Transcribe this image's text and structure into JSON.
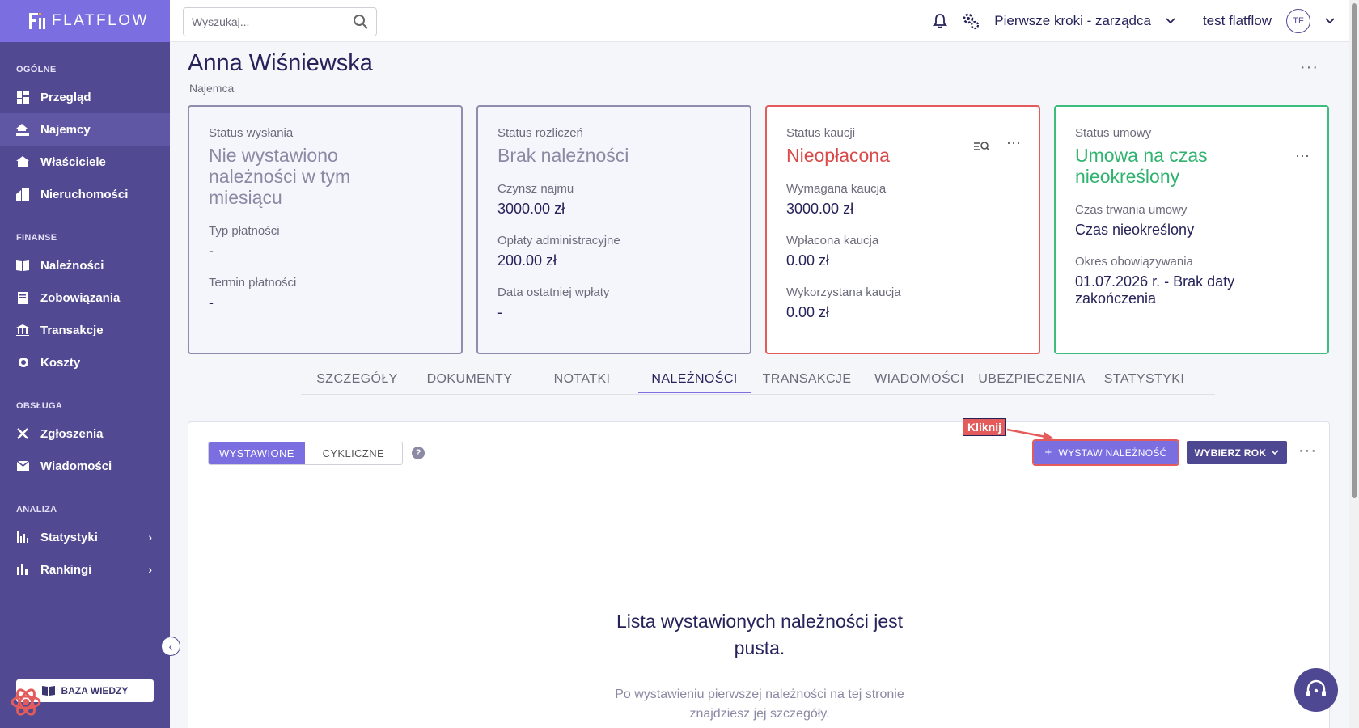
{
  "app": {
    "name": "FLATFLOW"
  },
  "search": {
    "placeholder": "Wyszukaj..."
  },
  "topbar": {
    "company": "Pierwsze kroki - zarządca",
    "user": "test flatflow",
    "avatar_initials": "TF"
  },
  "sidebar": {
    "sections": [
      {
        "title": "OGÓLNE",
        "items": [
          {
            "label": "Przegląd"
          },
          {
            "label": "Najemcy"
          },
          {
            "label": "Właściciele"
          },
          {
            "label": "Nieruchomości"
          }
        ]
      },
      {
        "title": "FINANSE",
        "items": [
          {
            "label": "Należności"
          },
          {
            "label": "Zobowiązania"
          },
          {
            "label": "Transakcje"
          },
          {
            "label": "Koszty"
          }
        ]
      },
      {
        "title": "OBSŁUGA",
        "items": [
          {
            "label": "Zgłoszenia"
          },
          {
            "label": "Wiadomości"
          }
        ]
      },
      {
        "title": "ANALIZA",
        "items": [
          {
            "label": "Statystyki"
          },
          {
            "label": "Rankingi"
          }
        ]
      }
    ],
    "knowledge_base": "BAZA WIEDZY"
  },
  "page": {
    "title": "Anna Wiśniewska",
    "subtitle": "Najemca"
  },
  "cards": {
    "sending": {
      "label": "Status wysłania",
      "status": "Nie wystawiono należności w tym miesiącu",
      "payment_type_label": "Typ płatności",
      "payment_type": "-",
      "deadline_label": "Termin płatności",
      "deadline": "-"
    },
    "settlements": {
      "label": "Status rozliczeń",
      "status": "Brak należności",
      "rent_label": "Czynsz najmu",
      "rent": "3000.00 zł",
      "fees_label": "Opłaty administracyjne",
      "fees": "200.00 zł",
      "last_payment_label": "Data ostatniej wpłaty",
      "last_payment": "-"
    },
    "deposit": {
      "label": "Status kaucji",
      "status": "Nieopłacona",
      "required_label": "Wymagana kaucja",
      "required": "3000.00 zł",
      "paid_label": "Wpłacona kaucja",
      "paid": "0.00 zł",
      "used_label": "Wykorzystana kaucja",
      "used": "0.00 zł"
    },
    "contract": {
      "label": "Status umowy",
      "status": "Umowa na czas nieokreślony",
      "duration_label": "Czas trwania umowy",
      "duration": "Czas nieokreślony",
      "period_label": "Okres obowiązywania",
      "period": "01.07.2026 r. - Brak daty zakończenia"
    }
  },
  "tabs": [
    {
      "label": "SZCZEGÓŁY"
    },
    {
      "label": "DOKUMENTY"
    },
    {
      "label": "NOTATKI"
    },
    {
      "label": "NALEŻNOŚCI"
    },
    {
      "label": "TRANSAKCJE"
    },
    {
      "label": "WIADOMOŚCI"
    },
    {
      "label": "UBEZPIECZENIA"
    },
    {
      "label": "STATYSTYKI"
    }
  ],
  "active_tab": "NALEŻNOŚCI",
  "panel": {
    "segment_on": "WYSTAWIONE",
    "segment_off": "CYKLICZNE",
    "add_button": "WYSTAW NALEŻNOŚĆ",
    "year_button": "WYBIERZ ROK",
    "empty_title": "Lista wystawionych należności jest pusta.",
    "empty_sub": "Po wystawieniu pierwszej należności na tej stronie znajdziesz jej szczegóły."
  },
  "annotation": {
    "label": "Kliknij"
  },
  "colors": {
    "sidebar": "#514a93",
    "accent": "#7a6ee0",
    "danger": "#e35b5b",
    "success": "#3dbd7d"
  }
}
